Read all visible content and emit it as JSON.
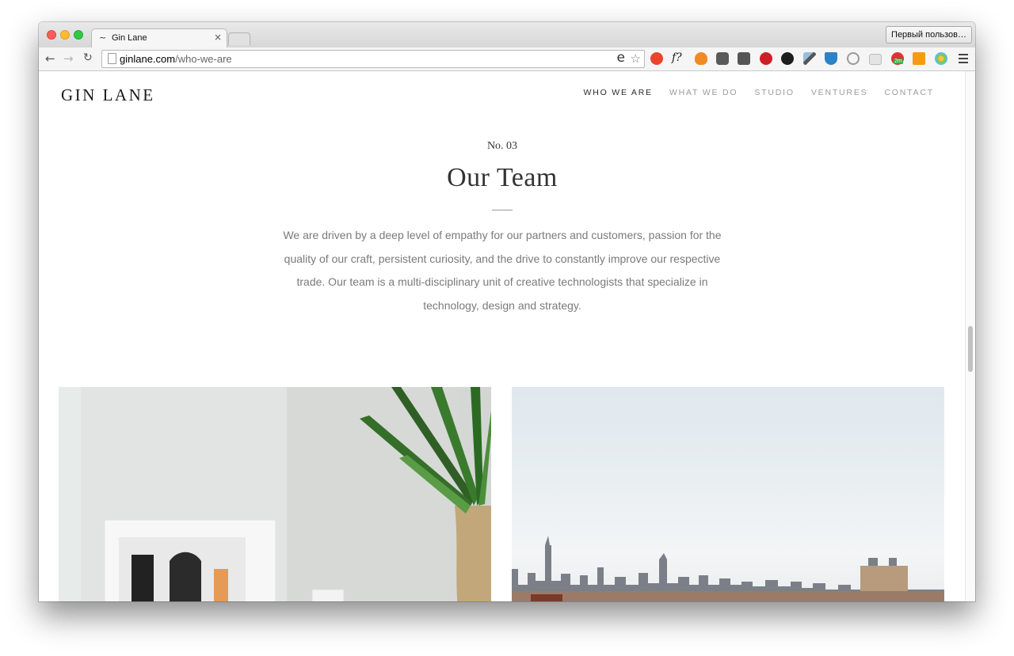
{
  "browser": {
    "tab_title": "Gin Lane",
    "tab_favicon": "~",
    "tab_close": "×",
    "profile": "Первый пользов…",
    "url_host": "ginlane.com",
    "url_path": "/who-we-are",
    "omnibox_ext": "e",
    "star": "☆",
    "back": "←",
    "forward": "→",
    "reload": "↻",
    "extensions": [
      "adblock-icon",
      "fonts-icon",
      "flame-icon",
      "evernote-icon",
      "pocket-icon",
      "pinterest-icon",
      "camera-icon",
      "eyedropper-icon",
      "y-icon",
      "circle-arrow-icon",
      "reader-icon",
      "timer-icon",
      "chart-icon",
      "colorful-icon"
    ],
    "ext_f_label": "f?",
    "ext_badge": "2m"
  },
  "site": {
    "logo": "GIN LANE",
    "nav": [
      {
        "label": "WHO WE ARE",
        "active": true
      },
      {
        "label": "WHAT WE DO",
        "active": false
      },
      {
        "label": "STUDIO",
        "active": false
      },
      {
        "label": "VENTURES",
        "active": false
      },
      {
        "label": "CONTACT",
        "active": false
      }
    ]
  },
  "section": {
    "kicker": "No. 03",
    "title": "Our Team",
    "body": "We are driven by a deep level of empathy for our partners and customers, passion for the quality of our craft, persistent curiosity, and the drive to constantly improve our respective trade. Our team is a multi-disciplinary unit of creative technologists that specialize in technology, design and strategy."
  },
  "colors": {
    "accent_text": "#333333",
    "muted_text": "#7a7a7a",
    "nav_inactive": "#9a9a9a"
  }
}
